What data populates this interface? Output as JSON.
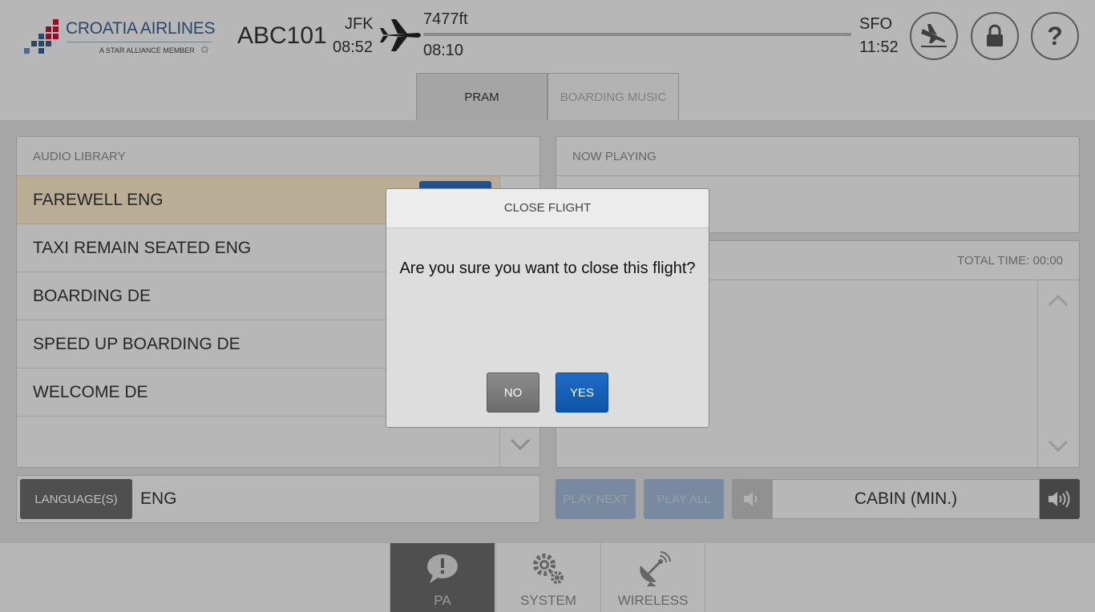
{
  "header": {
    "logo": {
      "name": "CROATIA AIRLINES",
      "tagline": "A STAR ALLIANCE MEMBER"
    },
    "flight_number": "ABC101",
    "origin": {
      "code": "JFK",
      "time": "08:52"
    },
    "altitude": "7477ft",
    "elapsed": "08:10",
    "destination": {
      "code": "SFO",
      "time": "11:52"
    },
    "buttons": {
      "close_flight_icon": "plane-landing-icon",
      "lock_icon": "lock-icon",
      "help_label": "?"
    }
  },
  "tabs": [
    {
      "label": "PRAM",
      "active": true
    },
    {
      "label": "BOARDING MUSIC",
      "active": false
    }
  ],
  "audio_library": {
    "title": "AUDIO LIBRARY",
    "items": [
      {
        "label": "FAREWELL ENG",
        "selected": true
      },
      {
        "label": "TAXI REMAIN SEATED ENG",
        "selected": false
      },
      {
        "label": "BOARDING DE",
        "selected": false
      },
      {
        "label": "SPEED UP BOARDING DE",
        "selected": false
      },
      {
        "label": "WELCOME DE",
        "selected": false
      }
    ]
  },
  "language": {
    "button_label": "LANGUAGE(S)",
    "value": "ENG"
  },
  "now_playing": {
    "title": "NOW PLAYING"
  },
  "playlist": {
    "total_time": "TOTAL TIME: 00:00"
  },
  "controls": {
    "play_next": "PLAY NEXT",
    "play_all": "PLAY ALL",
    "volume_label": "CABIN (MIN.)"
  },
  "bottom_nav": [
    {
      "label": "PA",
      "icon": "speech-bubble-icon",
      "active": true
    },
    {
      "label": "SYSTEM",
      "icon": "gears-icon",
      "active": false
    },
    {
      "label": "WIRELESS",
      "icon": "satellite-dish-icon",
      "active": false
    }
  ],
  "modal": {
    "title": "CLOSE FLIGHT",
    "message": "Are you sure you want to close this flight?",
    "no_label": "NO",
    "yes_label": "YES"
  },
  "colors": {
    "accent_blue": "#1565c0",
    "selected_row": "#f8e7c8",
    "logo_blue": "#3b5e8a",
    "logo_red": "#c8102e"
  }
}
